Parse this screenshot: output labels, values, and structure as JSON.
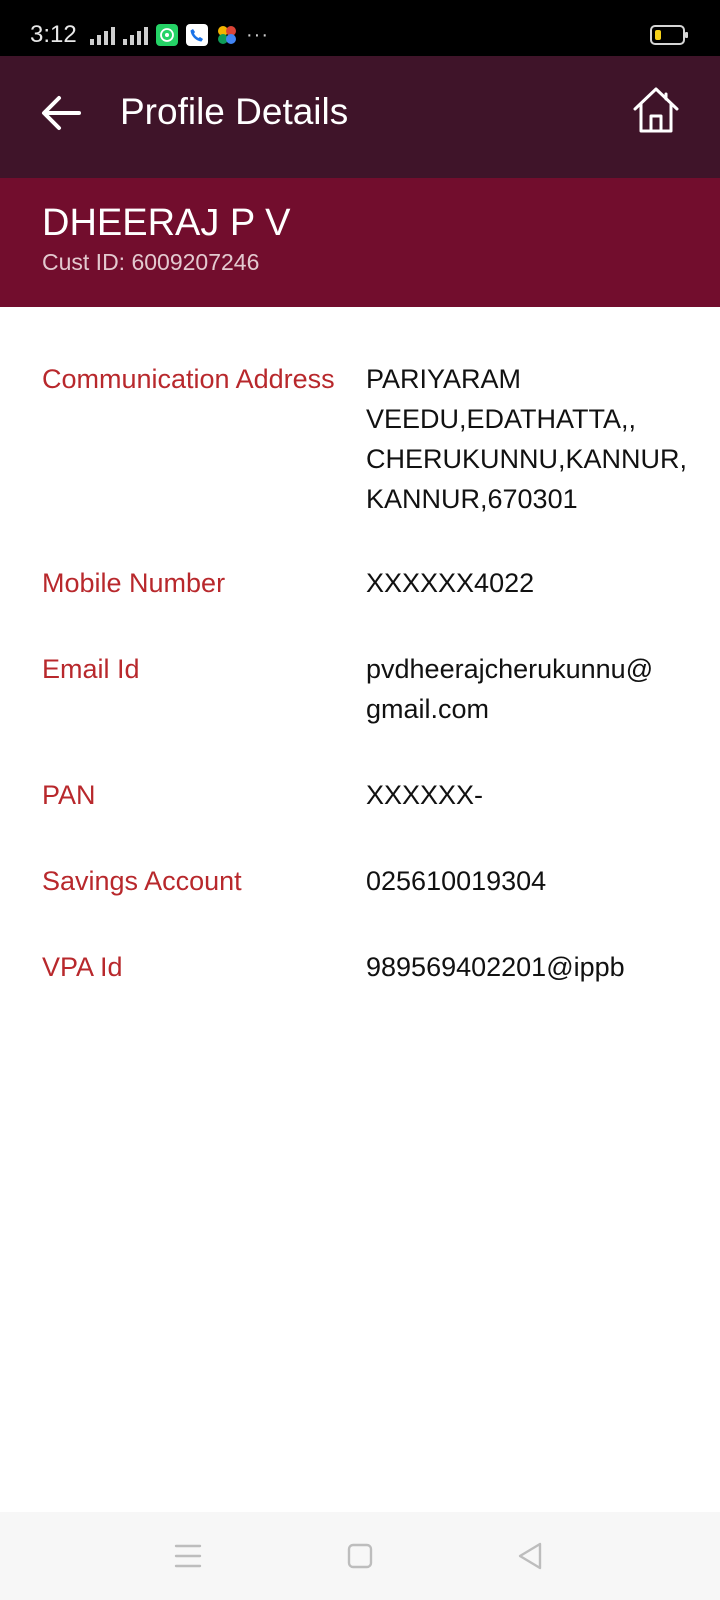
{
  "status_bar": {
    "time": "3:12",
    "icons": [
      "signal-hplus-icon",
      "signal-icon",
      "whatsapp-icon",
      "phone-app-icon",
      "pinwheel-app-icon",
      "more-notifications-icon",
      "battery-icon"
    ],
    "more": "···"
  },
  "app_bar": {
    "title": "Profile Details",
    "back_icon": "arrow-left-icon",
    "home_icon": "home-icon"
  },
  "profile": {
    "name": "DHEERAJ P V",
    "cust_id_label": "Cust ID:",
    "cust_id": "6009207246"
  },
  "details": [
    {
      "label": "Communication Address",
      "value": "PARIYARAM VEEDU,EDATHATTA,, CHERUKUNNU,KANNUR, KANNUR,670301"
    },
    {
      "label": "Mobile Number",
      "value": "XXXXXX4022"
    },
    {
      "label": "Email Id",
      "value": "pvdheerajcherukunnu@gmail.com"
    },
    {
      "label": "PAN",
      "value": "XXXXXX-"
    },
    {
      "label": "Savings Account",
      "value": "025610019304"
    },
    {
      "label": "VPA Id",
      "value": "989569402201@ippb"
    }
  ],
  "nav_bar": {
    "icons": [
      "menu-icon",
      "home-square-icon",
      "back-triangle-icon"
    ]
  },
  "colors": {
    "status_bar": "#000000",
    "app_bar": "#3f1429",
    "profile_header": "#720d2d",
    "label_text": "#b8282c",
    "value_text": "#111111"
  }
}
